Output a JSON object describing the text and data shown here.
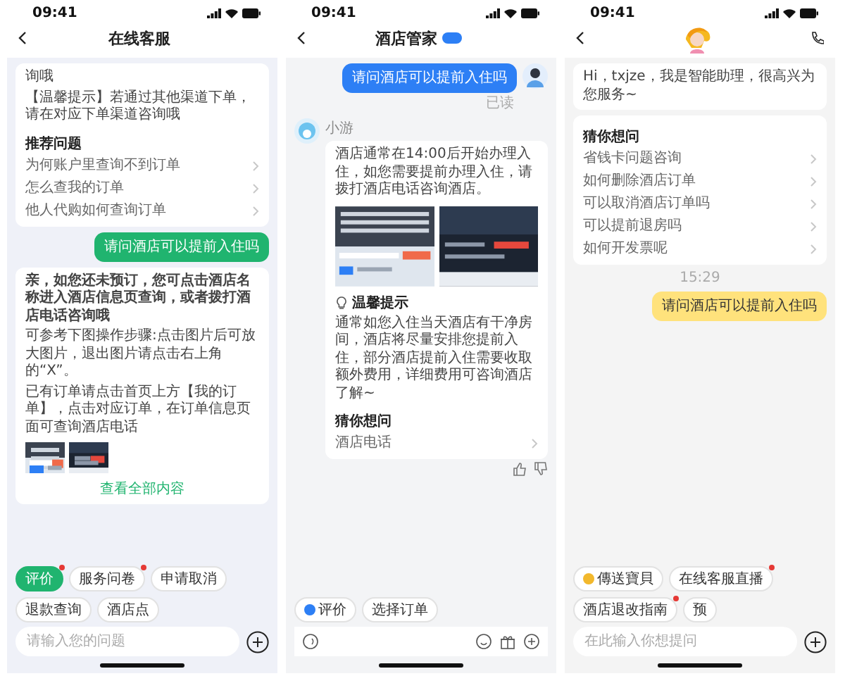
{
  "phones": [
    {
      "kind": "green",
      "time": "09:41",
      "header": {
        "kind": "title",
        "title": "在线客服"
      },
      "messages": [
        {
          "kind": "card",
          "paragraphs": [
            "询哦",
            "【温馨提示】若通过其他渠道下单，请在对应下单渠道咨询哦"
          ],
          "heading": "推荐问题",
          "items": [
            "为何账户里查询不到订单",
            "怎么查我的订单",
            "他人代购如何查询订单"
          ]
        },
        {
          "kind": "user",
          "text": "请问酒店可以提前入住吗"
        },
        {
          "kind": "card",
          "paragraphs": [
            "**亲，如您还未预订，您可点击酒店名称进入酒店信息页查询，或者拨打酒店电话咨询哦**",
            "可参考下图操作步骤:点击图片后可放大图片，退出图片请点击右上角的“X”。",
            "已有订单请点击首页上方【我的订单】，点击对应订单，在订单信息页面可查询酒店电话"
          ],
          "images": [
            {
              "kind": "picture"
            },
            {
              "kind": "picture"
            }
          ],
          "link": "查看全部内容"
        }
      ],
      "chips": [
        {
          "label": "评价",
          "selected": true,
          "dot": true
        },
        {
          "label": "服务问卷",
          "selected": false,
          "dot": true
        },
        {
          "label": "申请取消",
          "selected": false,
          "dot": false
        },
        {
          "label": "退款查询",
          "selected": false,
          "dot": false
        },
        {
          "label": "酒店点",
          "selected": false,
          "dot": false
        }
      ],
      "input": {
        "kind": "text",
        "placeholder": "请输入您的问题"
      }
    },
    {
      "kind": "blue",
      "time": "09:41",
      "header": {
        "kind": "title",
        "title": "酒店管家",
        "badge": true
      },
      "messages": [
        {
          "kind": "user",
          "text": "请问酒店可以提前入住吗",
          "avatar": true,
          "receipt": "已读"
        },
        {
          "kind": "bot",
          "sender": "小游",
          "paragraphs": [
            "酒店通常在14:00后开始办理入住，如您需要提前办理入住，请拨打酒店电话咨询酒店。"
          ],
          "images": [
            {
              "kind": "picture"
            },
            {
              "kind": "picture"
            }
          ],
          "tip": {
            "title": "温馨提示",
            "text": "通常如您入住当天酒店有干净房间，酒店将尽量安排您提前入住，部分酒店提前入住需要收取额外费用，详细费用可咨询酒店了解~"
          },
          "heading": "猜你想问",
          "items": [
            "酒店电话"
          ],
          "feedback": true
        }
      ],
      "chips": [
        {
          "label": "评价",
          "selected": false,
          "dot": false,
          "icon": true
        },
        {
          "label": "选择订单",
          "selected": false,
          "dot": false
        }
      ],
      "input": {
        "kind": "voice"
      }
    },
    {
      "kind": "yellow",
      "time": "09:41",
      "header": {
        "kind": "avatar",
        "call": true
      },
      "messages": [
        {
          "kind": "card",
          "paragraphs": [
            "Hi，txjze，我是智能助理，很高兴为您服务~"
          ]
        },
        {
          "kind": "card",
          "heading": "猜你想问",
          "items": [
            "省钱卡问题咨询",
            "如何删除酒店订单",
            "可以取消酒店订单吗",
            "可以提前退房吗",
            "如何开发票呢"
          ]
        },
        {
          "kind": "time",
          "text": "15:29"
        },
        {
          "kind": "user",
          "text": "请问酒店可以提前入住吗"
        }
      ],
      "chips": [
        {
          "label": "傳送寶貝",
          "selected": false,
          "dot": false,
          "icon": true
        },
        {
          "label": "在线客服直播",
          "selected": false,
          "dot": true
        },
        {
          "label": "酒店退改指南",
          "selected": false,
          "dot": true
        },
        {
          "label": "预",
          "selected": false,
          "dot": false
        }
      ],
      "input": {
        "kind": "text",
        "placeholder": "在此输入你想提问"
      }
    }
  ]
}
